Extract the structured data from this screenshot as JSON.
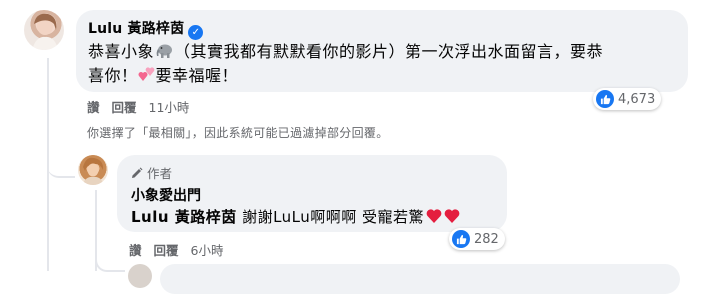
{
  "comment": {
    "author_name": "Lulu 黃路梓茵",
    "text_line1": "恭喜小象",
    "text_line1b": "（其實我都有默默看你的影片）第一次浮出水面留言，要恭",
    "text_line2a": "喜你！",
    "text_line2b": "要幸福喔！",
    "actions": {
      "like": "讚",
      "reply": "回覆",
      "time": "11小時"
    },
    "reaction_count": "4,673"
  },
  "filter_note": "你選擇了「最相關」，因此系統可能已過濾掉部分回覆。",
  "reply": {
    "author_tag": "作者",
    "author_name": "小象愛出門",
    "mention": "Lulu 黃路梓茵",
    "text": "謝謝LuLu啊啊啊 受寵若驚",
    "actions": {
      "like": "讚",
      "reply": "回覆",
      "time": "6小時"
    },
    "reaction_count": "282"
  },
  "colors": {
    "accent": "#1877f2",
    "bubble": "#f0f2f5",
    "muted": "#65676b",
    "heart": "#e41e3f"
  },
  "icons": [
    "elephant-emoji",
    "two-hearts-emoji",
    "heart-emoji",
    "like-icon",
    "pencil-icon",
    "verified-badge-icon"
  ]
}
